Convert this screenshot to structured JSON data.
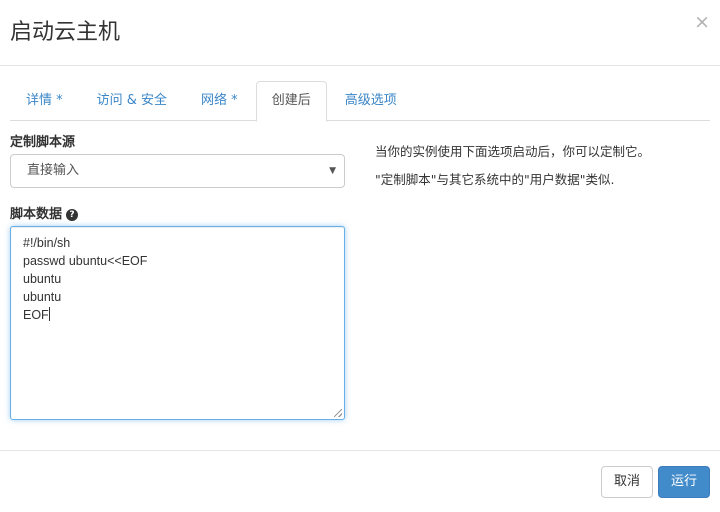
{
  "modal": {
    "title": "启动云主机",
    "close_label": "×"
  },
  "tabs": [
    {
      "label": "详情 *"
    },
    {
      "label": "访问 & 安全"
    },
    {
      "label": "网络 *"
    },
    {
      "label": "创建后",
      "active": true
    },
    {
      "label": "高级选项"
    }
  ],
  "form": {
    "source_label": "定制脚本源",
    "source_value": "直接输入",
    "script_label": "脚本数据",
    "script_lines": [
      "#!/bin/sh",
      "passwd ubuntu<<EOF",
      "ubuntu",
      "ubuntu",
      "EOF"
    ]
  },
  "help": {
    "line1": "当你的实例使用下面选项启动后，你可以定制它。",
    "line2": "\"定制脚本\"与其它系统中的\"用户数据\"类似."
  },
  "footer": {
    "cancel_label": "取消",
    "run_label": "运行"
  },
  "colors": {
    "accent": "#428bca",
    "link": "#3a86c8",
    "focus_border": "#66afe9"
  }
}
